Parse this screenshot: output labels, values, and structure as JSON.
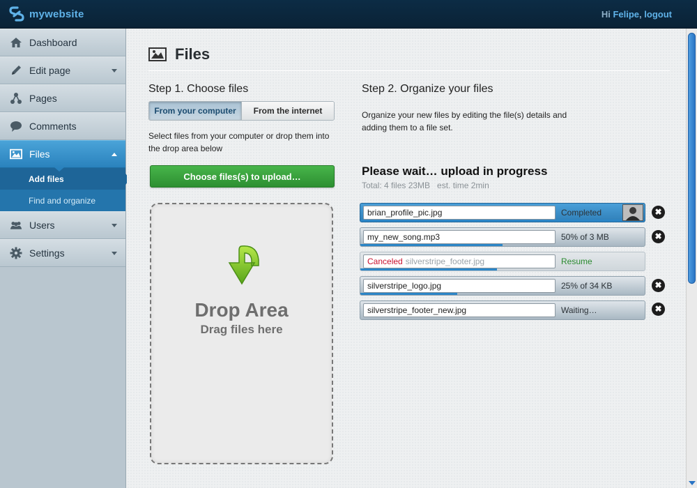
{
  "header": {
    "brand": "mywebsite",
    "greeting_prefix": "Hi",
    "user": "Felipe",
    "separator": ",",
    "logout": "logout"
  },
  "sidebar": {
    "items": [
      {
        "label": "Dashboard",
        "icon": "home-icon"
      },
      {
        "label": "Edit page",
        "icon": "pencil-icon"
      },
      {
        "label": "Pages",
        "icon": "sitemap-icon"
      },
      {
        "label": "Comments",
        "icon": "speech-bubble-icon"
      },
      {
        "label": "Files",
        "icon": "image-icon"
      },
      {
        "label": "Users",
        "icon": "users-icon"
      },
      {
        "label": "Settings",
        "icon": "gear-icon"
      }
    ],
    "sub_items": [
      {
        "label": "Add files"
      },
      {
        "label": "Find and organize"
      }
    ]
  },
  "page": {
    "title": "Files",
    "step1": {
      "title": "Step 1. Choose files",
      "tab_computer": "From your computer",
      "tab_internet": "From the internet",
      "description_line1": "Select files from your computer or drop them into",
      "description_line2": "the drop area below",
      "upload_button": "Choose files(s) to upload…",
      "drop_title": "Drop Area",
      "drop_subtitle": "Drag files here"
    },
    "step2": {
      "title": "Step 2. Organize your files",
      "description_line1": "Organize your new files by editing the file(s) details and",
      "description_line2": "adding them to a file set.",
      "progress_heading": "Please wait… upload in progress",
      "total_label": "Total: 4 files 23MB",
      "estimate_label": "est. time 2min"
    },
    "files": [
      {
        "name": "brian_profile_pic.jpg",
        "status": "Completed",
        "progress": 1.0
      },
      {
        "name": "my_new_song.mp3",
        "status": "50% of 3 MB",
        "progress": 0.5
      },
      {
        "name": "silverstripe_footer.jpg",
        "prefix": "Canceled",
        "status": "Resume",
        "progress": 0.48
      },
      {
        "name": "silverstripe_logo.jpg",
        "status": "25% of 34 KB",
        "progress": 0.34
      },
      {
        "name": "silverstripe_footer_new.jpg",
        "status": "Waiting…",
        "progress": 0
      }
    ],
    "remove_glyph": "✖"
  },
  "colors": {
    "accent": "#2a82bd",
    "brand": "#5fb2e8",
    "upload_button": "#2d8f31",
    "canceled": "#c8102e",
    "resume": "#2a8a2f"
  }
}
